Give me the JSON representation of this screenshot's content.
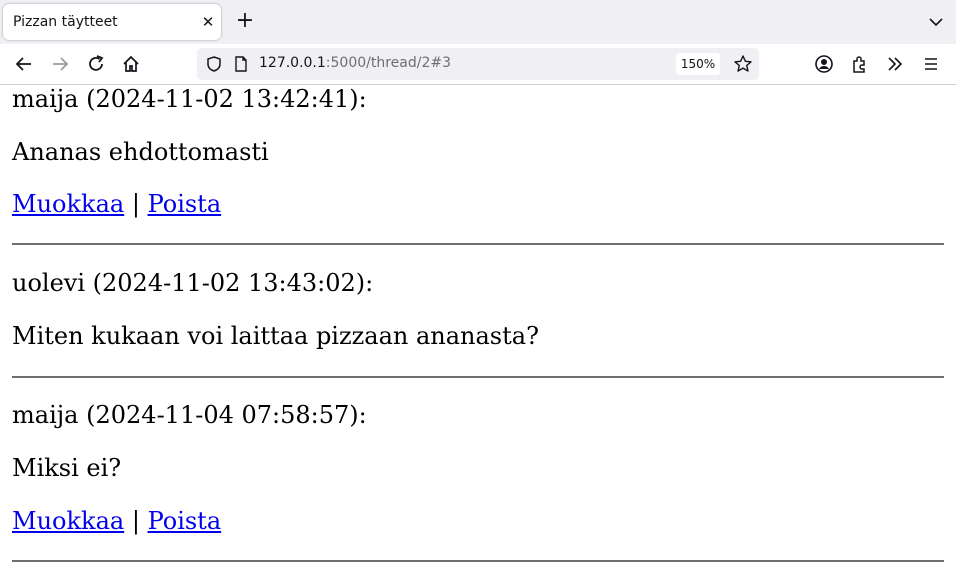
{
  "browser": {
    "tab": {
      "title": "Pizzan täytteet"
    },
    "url": {
      "host": "127.0.0.1",
      "rest": ":5000/thread/2#3"
    },
    "zoom": "150%"
  },
  "messages": [
    {
      "header": "maija (2024-11-02 13:42:41):",
      "body": "Ananas ehdottomasti",
      "edit_label": "Muokkaa",
      "separator": "|",
      "delete_label": "Poista"
    },
    {
      "header": "uolevi (2024-11-02 13:43:02):",
      "body": "Miten kukaan voi laittaa pizzaan ananasta?"
    },
    {
      "header": "maija (2024-11-04 07:58:57):",
      "body": "Miksi ei?",
      "edit_label": "Muokkaa",
      "separator": "|",
      "delete_label": "Poista"
    }
  ]
}
